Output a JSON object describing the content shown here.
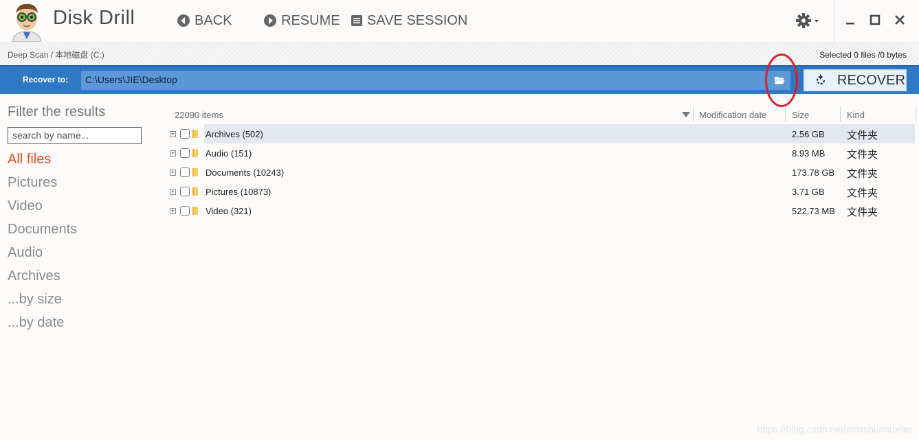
{
  "app": {
    "title": "Disk Drill"
  },
  "toolbar": {
    "back": "BACK",
    "resume": "RESUME",
    "save_session": "SAVE SESSION"
  },
  "breadcrumb": "Deep Scan / 本地磁盘 (C:)",
  "selection_status": "Selected 0 files /0 bytes",
  "recover": {
    "label": "Recover to:",
    "path": "C:\\Users\\JIE\\Desktop",
    "button": "RECOVER"
  },
  "sidebar": {
    "title": "Filter the results",
    "search_placeholder": "search by name...",
    "items": [
      {
        "label": "All files",
        "active": true
      },
      {
        "label": "Pictures"
      },
      {
        "label": "Video"
      },
      {
        "label": "Documents"
      },
      {
        "label": "Audio"
      },
      {
        "label": "Archives"
      },
      {
        "label": "...by size"
      },
      {
        "label": "...by date"
      }
    ]
  },
  "table": {
    "count": "22090 items",
    "columns": {
      "modified": "Modification date",
      "size": "Size",
      "kind": "Kind"
    },
    "rows": [
      {
        "name": "Archives (502)",
        "size": "2.56 GB",
        "kind": "文件夹"
      },
      {
        "name": "Audio (151)",
        "size": "8.93 MB",
        "kind": "文件夹"
      },
      {
        "name": "Documents (10243)",
        "size": "173.78 GB",
        "kind": "文件夹"
      },
      {
        "name": "Pictures (10873)",
        "size": "3.71 GB",
        "kind": "文件夹"
      },
      {
        "name": "Video (321)",
        "size": "522.73 MB",
        "kind": "文件夹"
      }
    ]
  },
  "watermark": "https://blog.csdn.net/smxshuimuxiao",
  "colors": {
    "accent": "#2f78c3",
    "active_filter": "#ee4b22",
    "annotation": "#e11d25"
  }
}
